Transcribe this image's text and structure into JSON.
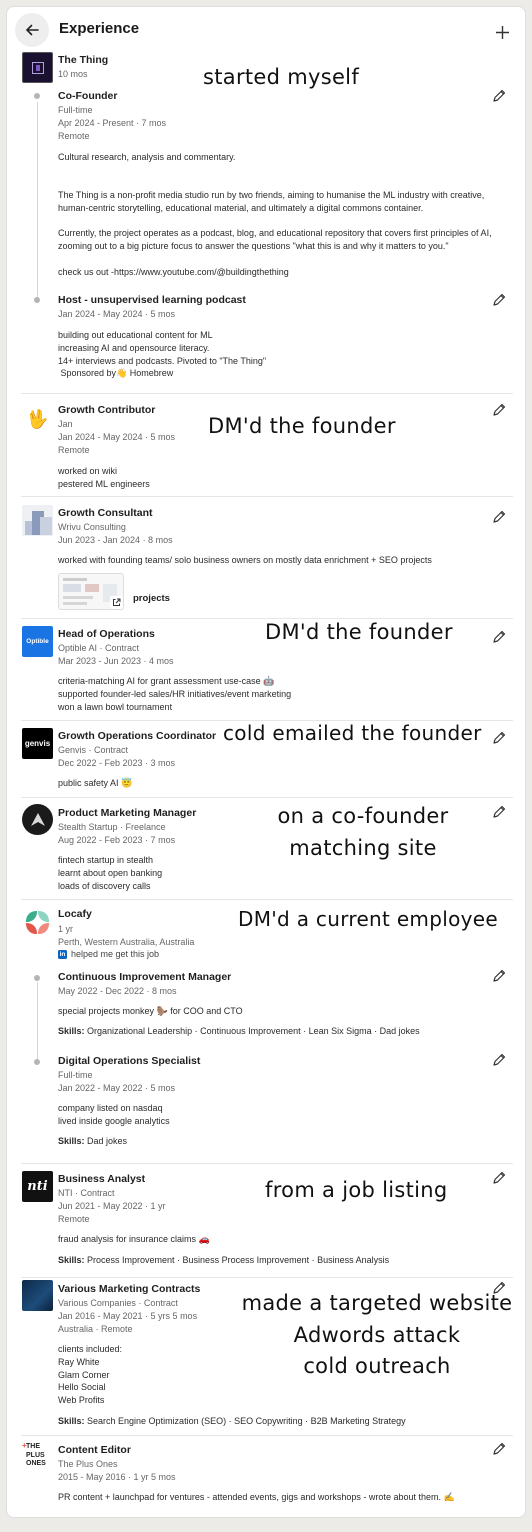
{
  "header": {
    "title": "Experience",
    "back_icon": "arrow-left-icon",
    "add_icon": "plus-icon"
  },
  "entries": {
    "thething": {
      "company": "The Thing",
      "duration": "10 mos",
      "roles": [
        {
          "title": "Co-Founder",
          "type": "Full-time",
          "dates": "Apr 2024 - Present · 7 mos",
          "location": "Remote",
          "desc1": "Cultural research, analysis and commentary.",
          "desc2": "The Thing is a non-profit media studio run by two friends, aiming to humanise the ML industry with creative, human-centric storytelling, educational material, and ultimately a digital commons container.",
          "desc3": "Currently, the project operates as a podcast, blog, and educational repository that covers first principles of AI, zooming out to a big picture focus to answer the questions \"what this is and why it matters to you.\"",
          "desc4": "check us out -https://www.youtube.com/@buildingthething"
        },
        {
          "title": "Host - unsupervised learning podcast",
          "dates": "Jan 2024 - May 2024 · 5 mos",
          "desc": "building out educational content for ML\nincreasing AI and opensource literacy.\n14+ interviews and podcasts. Pivoted to \"The Thing\"\n Sponsored by👋 Homebrew"
        }
      ]
    },
    "jan": {
      "title": "Growth Contributor",
      "company": "Jan",
      "dates": "Jan 2024 - May 2024 · 5 mos",
      "location": "Remote",
      "desc": "worked on wiki\npestered ML engineers"
    },
    "wrivu": {
      "title": "Growth Consultant",
      "company": "Wrivu Consulting",
      "dates": "Jun 2023 - Jan 2024 · 8 mos",
      "desc": "worked with founding teams/ solo business owners on mostly data enrichment + SEO projects",
      "media_label": "projects"
    },
    "optible": {
      "logo_text": "Optible",
      "title": "Head of Operations",
      "company": "Optible AI · Contract",
      "dates": "Mar 2023 - Jun 2023 · 4 mos",
      "desc": "criteria-matching AI for grant assessment use-case 🤖\nsupported founder-led sales/HR initiatives/event marketing\nwon a lawn bowl tournament"
    },
    "genvis": {
      "logo_text": "genvis",
      "title": "Growth Operations Coordinator",
      "company": "Genvis · Contract",
      "dates": "Dec 2022 - Feb 2023 · 3 mos",
      "desc": "public safety AI 😇"
    },
    "stealth": {
      "title": "Product Marketing Manager",
      "company": "Stealth Startup · Freelance",
      "dates": "Aug 2022 - Feb 2023 · 7 mos",
      "desc": "fintech startup in stealth\nlearnt about open banking\nloads of discovery calls"
    },
    "locafy": {
      "company": "Locafy",
      "duration": "1 yr",
      "location": "Perth, Western Australia, Australia",
      "linkedin_note": "helped me get this job",
      "roles": [
        {
          "title": "Continuous Improvement Manager",
          "dates": "May 2022 - Dec 2022 · 8 mos",
          "desc": "special projects monkey 🦫 for COO and CTO",
          "skills_label": "Skills:",
          "skills": " Organizational Leadership · Continuous Improvement · Lean Six Sigma · Dad jokes"
        },
        {
          "title": "Digital Operations Specialist",
          "type": "Full-time",
          "dates": "Jan 2022 - May 2022 · 5 mos",
          "desc": "company listed on nasdaq\nlived inside google analytics",
          "skills_label": "Skills:",
          "skills": " Dad jokes"
        }
      ]
    },
    "nti": {
      "logo_text": "nti",
      "title": "Business Analyst",
      "company": "NTI · Contract",
      "dates": "Jun 2021 - May 2022 · 1 yr",
      "location": "Remote",
      "desc": "fraud analysis for insurance claims 🚗",
      "skills_label": "Skills:",
      "skills": " Process Improvement · Business Process Improvement · Business Analysis"
    },
    "various": {
      "title": "Various Marketing Contracts",
      "company": "Various Companies · Contract",
      "dates": "Jan 2016 - May 2021 · 5 yrs 5 mos",
      "location": "Australia · Remote",
      "desc": "clients included:\nRay White\nGlam Corner\nHello Social\nWeb Profits",
      "skills_label": "Skills:",
      "skills": " Search Engine Optimization (SEO) · SEO Copywriting · B2B Marketing Strategy"
    },
    "plusones": {
      "logo_text": "THE\nPLUS\nONES",
      "title": "Content Editor",
      "company": "The Plus Ones",
      "dates": "2015 - May 2016 · 1 yr 5 mos",
      "desc": "PR content + launchpad for ventures - attended events, gigs and workshops - wrote about them. ✍"
    }
  },
  "annotations": {
    "a1": "started myself",
    "a2": "DM'd the founder",
    "a3": "DM'd the founder",
    "a4": "cold emailed the founder",
    "a5_l1": "on a co-founder",
    "a5_l2": "matching site",
    "a6": "DM'd a current employee",
    "a7": "from a job listing",
    "a8_l1": "made a targeted website",
    "a8_l2": "Adwords attack",
    "a8_l3": "cold outreach"
  },
  "icons": {
    "edit": "pencil-icon",
    "external": "external-link-icon",
    "linkedin": "linkedin-icon"
  },
  "colors": {
    "optible_blue": "#1b74e4",
    "linkedin_blue": "#0a66c2",
    "locafy_green": "#3dae8c",
    "locafy_red": "#e2574c"
  }
}
